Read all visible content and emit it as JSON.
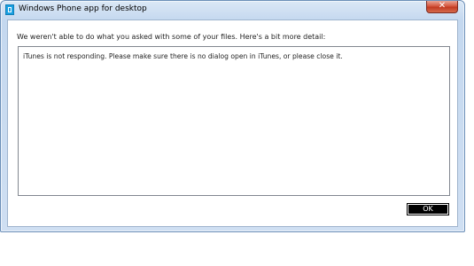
{
  "window": {
    "title": "Windows Phone app for desktop",
    "close_label": "✕"
  },
  "dialog": {
    "heading": "We weren't able to do what you asked with some of your files. Here's a bit more detail:",
    "detail": "iTunes is not responding.  Please make sure there is no dialog open in iTunes, or please close it.",
    "ok_label": "OK"
  },
  "colors": {
    "app_icon": "#1ba1e2",
    "close_button": "#c23a22",
    "ok_button": "#000000"
  },
  "icons": {
    "app": "windows-phone-app-icon",
    "close": "close-icon"
  }
}
